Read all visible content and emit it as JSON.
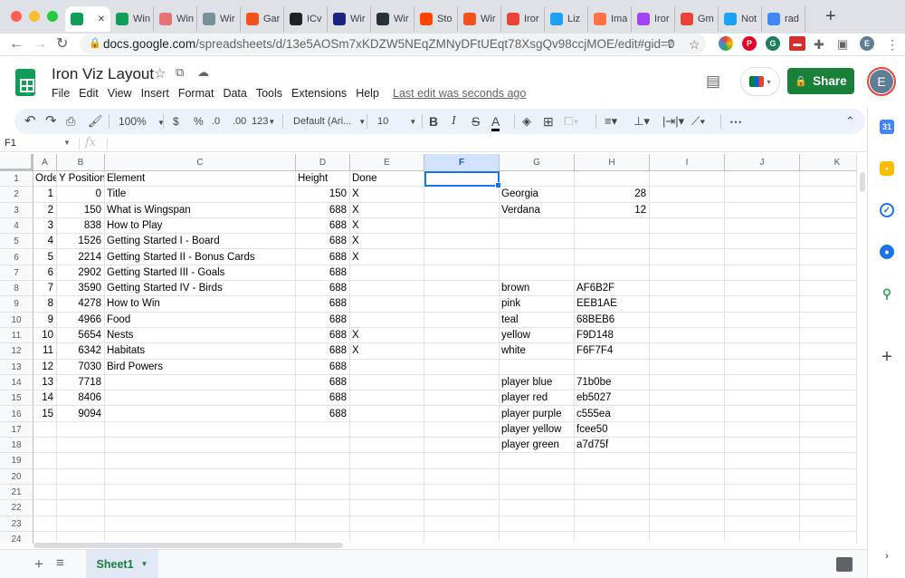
{
  "browser": {
    "tabs": [
      {
        "title": "",
        "favicon_color": "#0f9d58"
      },
      {
        "title": "Win",
        "favicon_color": "#0f9d58"
      },
      {
        "title": "Win",
        "favicon_color": "#e57373"
      },
      {
        "title": "Wir",
        "favicon_color": "#78909c"
      },
      {
        "title": "Gar",
        "favicon_color": "#f4511e"
      },
      {
        "title": "ICv",
        "favicon_color": "#212121"
      },
      {
        "title": "Wir",
        "favicon_color": "#1a237e"
      },
      {
        "title": "Wir",
        "favicon_color": "#263238"
      },
      {
        "title": "Sto",
        "favicon_color": "#ff4500"
      },
      {
        "title": "Wir",
        "favicon_color": "#f4511e"
      },
      {
        "title": "Iror",
        "favicon_color": "#ea4335"
      },
      {
        "title": "Liz",
        "favicon_color": "#1da1f2"
      },
      {
        "title": "Ima",
        "favicon_color": "#ff7043"
      },
      {
        "title": "Iror",
        "favicon_color": "#a142f4"
      },
      {
        "title": "Gm",
        "favicon_color": "#ea4335"
      },
      {
        "title": "Not",
        "favicon_color": "#1da1f2"
      },
      {
        "title": "rad",
        "favicon_color": "#4285f4"
      }
    ],
    "url_domain": "docs.google.com",
    "url_path": "/spreadsheets/d/13e5AOSm7xKDZW5NEqZMNyDFtUEqt78XsgQv98ccjMOE/edit#gid=0",
    "profile_initial": "E"
  },
  "doc": {
    "title": "Iron Viz Layout",
    "menus": [
      "File",
      "Edit",
      "View",
      "Insert",
      "Format",
      "Data",
      "Tools",
      "Extensions",
      "Help"
    ],
    "last_edit": "Last edit was seconds ago",
    "share_label": "Share",
    "account_initial": "E"
  },
  "toolbar": {
    "zoom": "100%",
    "currency": "$",
    "percent": "%",
    "decrease_decimal": ".0",
    "increase_decimal": ".00",
    "format_more": "123",
    "font": "Default (Ari...",
    "font_size": "10"
  },
  "formula_bar": {
    "name_box": "F1",
    "fx": "fx",
    "content": ""
  },
  "sheet": {
    "columns": [
      "A",
      "B",
      "C",
      "D",
      "E",
      "F",
      "G",
      "H",
      "I",
      "J",
      "K"
    ],
    "selected_column": "F",
    "row_numbers": [
      "1",
      "2",
      "3",
      "4",
      "5",
      "6",
      "7",
      "8",
      "9",
      "10",
      "11",
      "12",
      "13",
      "14",
      "15",
      "16",
      "17",
      "18",
      "19",
      "20",
      "21",
      "22",
      "23",
      "24"
    ],
    "rows": [
      [
        "Orde",
        "Y Position",
        "Element",
        "Height",
        "Done",
        "",
        "",
        "",
        "",
        "",
        ""
      ],
      [
        "1",
        "0",
        "Title",
        "150",
        "X",
        "",
        "Georgia",
        "28",
        "",
        "",
        ""
      ],
      [
        "2",
        "150",
        "What is Wingspan",
        "688",
        "X",
        "",
        "Verdana",
        "12",
        "",
        "",
        ""
      ],
      [
        "3",
        "838",
        "How to Play",
        "688",
        "X",
        "",
        "",
        "",
        "",
        "",
        ""
      ],
      [
        "4",
        "1526",
        "Getting Started I - Board",
        "688",
        "X",
        "",
        "",
        "",
        "",
        "",
        ""
      ],
      [
        "5",
        "2214",
        "Getting Started II - Bonus Cards",
        "688",
        "X",
        "",
        "",
        "",
        "",
        "",
        ""
      ],
      [
        "6",
        "2902",
        "Getting Started III - Goals",
        "688",
        "",
        "",
        "",
        "",
        "",
        "",
        ""
      ],
      [
        "7",
        "3590",
        "Getting Started IV - Birds",
        "688",
        "",
        "",
        "brown",
        "AF6B2F",
        "",
        "",
        ""
      ],
      [
        "8",
        "4278",
        "How to Win",
        "688",
        "",
        "",
        "pink",
        "EEB1AE",
        "",
        "",
        ""
      ],
      [
        "9",
        "4966",
        "Food",
        "688",
        "",
        "",
        "teal",
        "68BEB6",
        "",
        "",
        ""
      ],
      [
        "10",
        "5654",
        "Nests",
        "688",
        "X",
        "",
        "yellow",
        "F9D148",
        "",
        "",
        ""
      ],
      [
        "11",
        "6342",
        "Habitats",
        "688",
        "X",
        "",
        "white",
        "F6F7F4",
        "",
        "",
        ""
      ],
      [
        "12",
        "7030",
        "Bird Powers",
        "688",
        "",
        "",
        "",
        "",
        "",
        "",
        ""
      ],
      [
        "13",
        "7718",
        "",
        "688",
        "",
        "",
        "player blue",
        "71b0be",
        "",
        "",
        ""
      ],
      [
        "14",
        "8406",
        "",
        "688",
        "",
        "",
        "player red",
        "eb5027",
        "",
        "",
        ""
      ],
      [
        "15",
        "9094",
        "",
        "688",
        "",
        "",
        "player purple",
        "c555ea",
        "",
        "",
        ""
      ],
      [
        "",
        "",
        "",
        "",
        "",
        "",
        "player yellow",
        "fcee50",
        "",
        "",
        ""
      ],
      [
        "",
        "",
        "",
        "",
        "",
        "",
        "player green",
        "a7d75f",
        "",
        "",
        ""
      ],
      [
        "",
        "",
        "",
        "",
        "",
        "",
        "",
        "",
        "",
        "",
        ""
      ],
      [
        "",
        "",
        "",
        "",
        "",
        "",
        "",
        "",
        "",
        "",
        ""
      ],
      [
        "",
        "",
        "",
        "",
        "",
        "",
        "",
        "",
        "",
        "",
        ""
      ],
      [
        "",
        "",
        "",
        "",
        "",
        "",
        "",
        "",
        "",
        "",
        ""
      ],
      [
        "",
        "",
        "",
        "",
        "",
        "",
        "",
        "",
        "",
        "",
        ""
      ],
      [
        "",
        "",
        "",
        "",
        "",
        "",
        "",
        "",
        "",
        "",
        ""
      ]
    ]
  },
  "sheet_tabs": {
    "active": "Sheet1"
  },
  "colors": {
    "share_green": "#188038",
    "selection_blue": "#1a73e8",
    "toolbar_bg": "#edf2fa"
  }
}
